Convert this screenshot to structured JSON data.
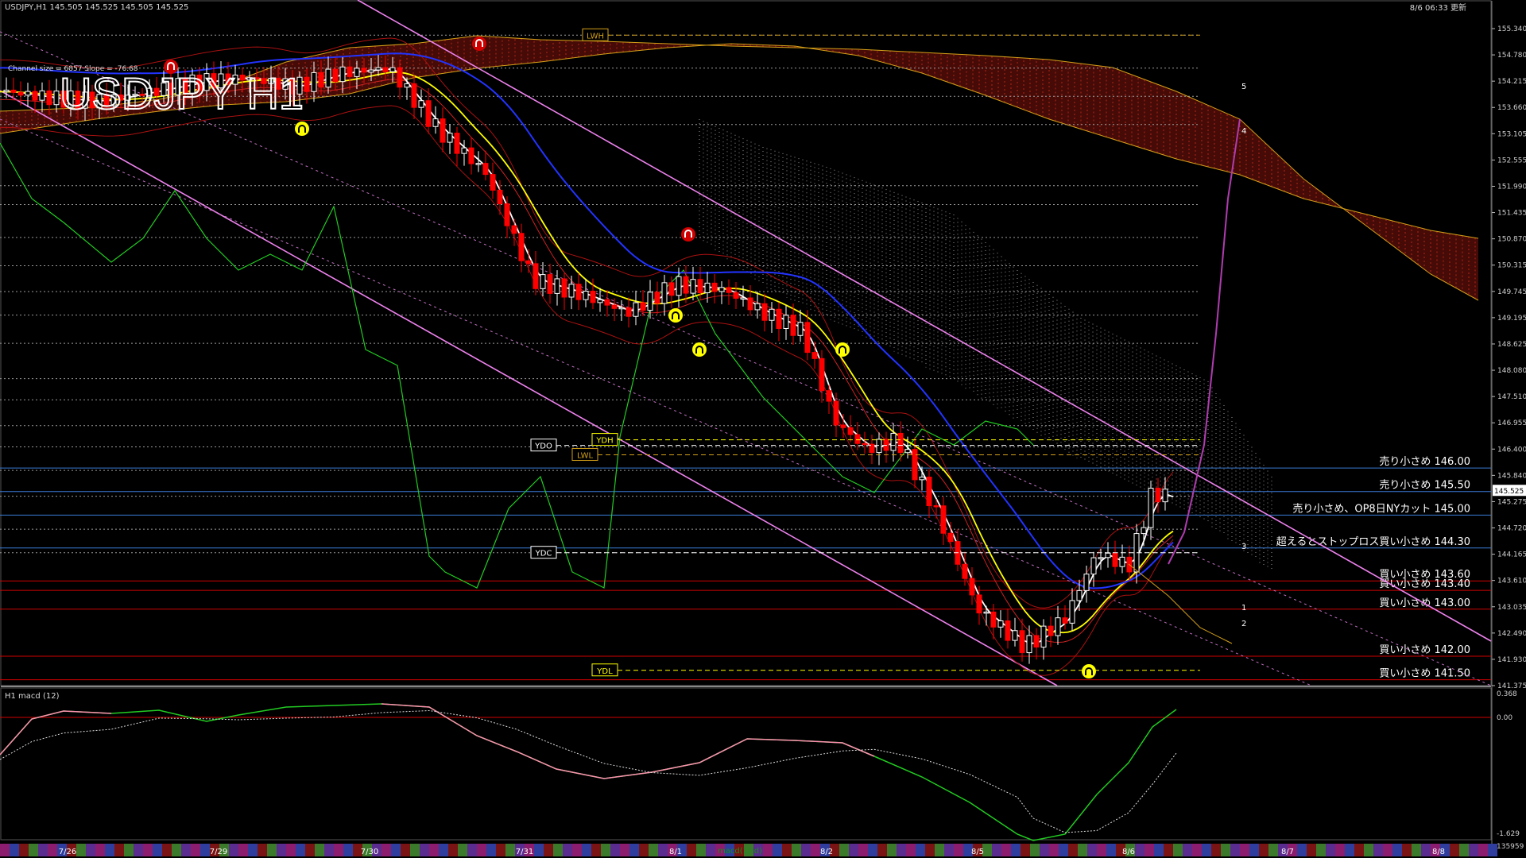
{
  "window": {
    "header_text": "USDJPY,H1  145.505 145.525 145.505 145.525",
    "clock_text": "8/6 06:33 更新",
    "channel_info": "Channel size = 6857 Slope = -76.68",
    "big_title": "USDJPY H1"
  },
  "macd": {
    "label": "H1 macd (12)",
    "axis_top": "0.368",
    "axis_zero": "0.00",
    "axis_bottom": "-1.629",
    "axis_extra": "135959",
    "watermark": "macd(1)(d)"
  },
  "price_axis": {
    "ticks": [
      "155.340",
      "154.780",
      "154.215",
      "153.660",
      "153.105",
      "152.555",
      "151.990",
      "151.435",
      "150.870",
      "150.315",
      "149.745",
      "149.195",
      "148.625",
      "148.080",
      "147.510",
      "146.955",
      "146.400",
      "145.840",
      "145.275",
      "144.720",
      "144.165",
      "143.610",
      "143.035",
      "142.490",
      "141.930",
      "141.375"
    ],
    "current_price": "145.525"
  },
  "colors": {
    "background": "#000000",
    "bull_candle": "#ffffff",
    "bear_candle": "#ff0000",
    "ma_fast": "#ffffff",
    "ma_yellow": "#ffff00",
    "ma_blue": "#2233ff",
    "channel": "#ee82ee",
    "oscillator": "#22cc22",
    "kumo": "#b0241a",
    "sell_level": "#3a7bd5",
    "buy_level": "#d00000"
  },
  "levels": [
    {
      "label": "売り小さめ 146.00",
      "price": 146.0,
      "kind": "sell"
    },
    {
      "label": "売り小さめ 145.50",
      "price": 145.5,
      "kind": "sell"
    },
    {
      "label": "売り小さめ、OP8日NYカット 145.00",
      "price": 145.0,
      "kind": "sell"
    },
    {
      "label": "超えるとストップロス買い小さめ 144.30",
      "price": 144.3,
      "kind": "sell"
    },
    {
      "label": "買い小さめ 143.60",
      "price": 143.6,
      "kind": "buy"
    },
    {
      "label": "買い小さめ 143.40",
      "price": 143.4,
      "kind": "buy"
    },
    {
      "label": "買い小さめ 143.00",
      "price": 143.0,
      "kind": "buy"
    },
    {
      "label": "買い小さめ 142.00",
      "price": 142.0,
      "kind": "buy"
    },
    {
      "label": "買い小さめ 141.50",
      "price": 141.5,
      "kind": "buy"
    }
  ],
  "ref_tags": [
    {
      "label": "LWH",
      "price": 155.2,
      "x": 735,
      "color": "#d4a017"
    },
    {
      "label": "YDO",
      "price": 146.48,
      "x": 670,
      "color": "#ffffff"
    },
    {
      "label": "YDH",
      "price": 146.6,
      "x": 747,
      "color": "#ffff00"
    },
    {
      "label": "LWL",
      "price": 146.28,
      "x": 722,
      "color": "#d4a017"
    },
    {
      "label": "YDC",
      "price": 144.2,
      "x": 670,
      "color": "#ffffff"
    },
    {
      "label": "YDL",
      "price": 141.7,
      "x": 747,
      "color": "#ffff00"
    }
  ],
  "wave_labels": [
    "5",
    "4",
    "3",
    "1",
    "2"
  ],
  "chart_data": {
    "type": "line",
    "title": "USDJPY H1",
    "xlabel": "",
    "ylabel": "",
    "ylim": [
      141.375,
      155.34
    ],
    "categories": [
      "7/26",
      "7/29",
      "7/30",
      "7/31",
      "8/1",
      "8/2",
      "8/5",
      "8/6",
      "8/7",
      "8/8"
    ],
    "series": [
      {
        "name": "USDJPY,H1",
        "values": [
          154.2,
          153.9,
          154.1,
          154.3,
          153.8,
          153.5,
          152.9,
          151.8,
          150.3,
          149.9,
          149.6,
          149.3,
          149.4,
          149.5,
          149.1,
          148.6,
          147.2,
          146.4,
          144.9,
          143.2,
          142.4,
          142.3,
          143.7,
          143.6,
          145.5
        ]
      }
    ],
    "macd_zero_line": 0.0,
    "macd_range": [
      -1.629,
      0.368
    ]
  }
}
